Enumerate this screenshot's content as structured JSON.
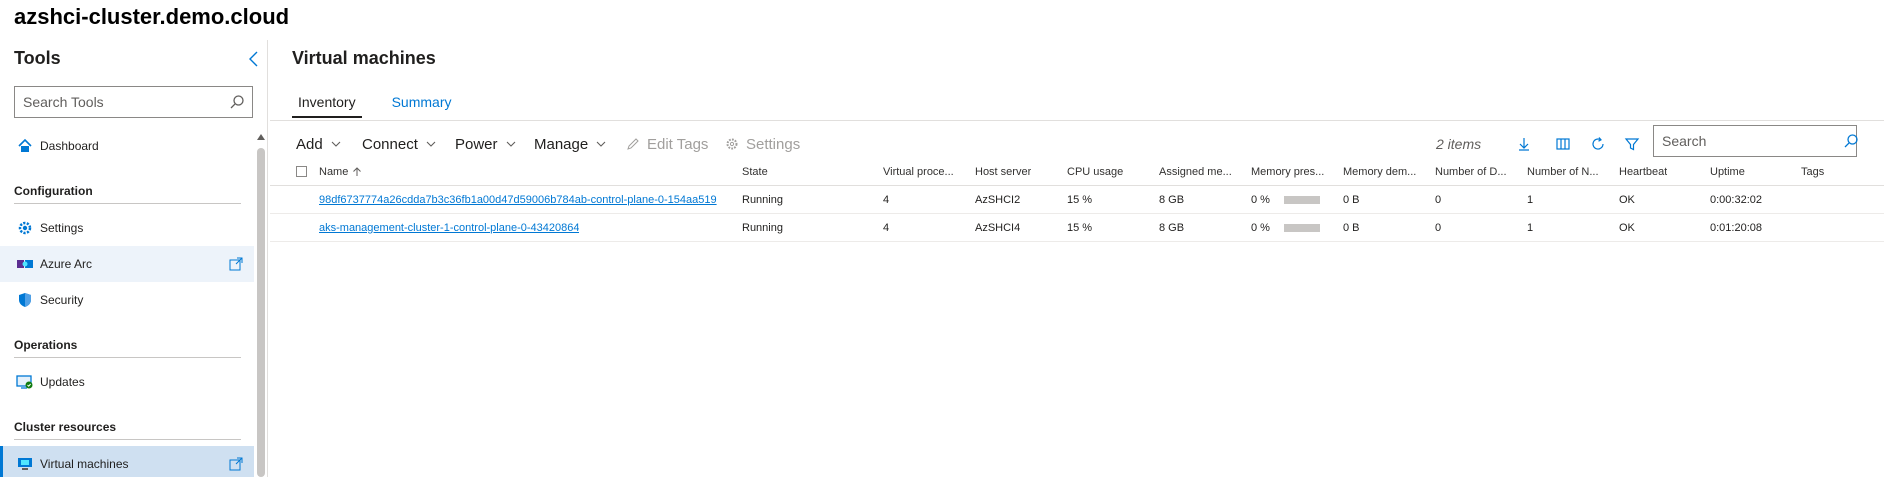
{
  "app": {
    "title": "azshci-cluster.demo.cloud"
  },
  "sidebar": {
    "header": "Tools",
    "search_placeholder": "Search Tools",
    "items": [
      {
        "type": "item",
        "label": "Dashboard",
        "icon": "home-icon"
      },
      {
        "type": "group",
        "label": "Configuration"
      },
      {
        "type": "item",
        "label": "Settings",
        "icon": "gear-icon"
      },
      {
        "type": "item",
        "label": "Azure Arc",
        "icon": "azure-arc-icon",
        "external": true
      },
      {
        "type": "item",
        "label": "Security",
        "icon": "shield-icon"
      },
      {
        "type": "group",
        "label": "Operations"
      },
      {
        "type": "item",
        "label": "Updates",
        "icon": "updates-icon"
      },
      {
        "type": "group",
        "label": "Cluster resources"
      },
      {
        "type": "item",
        "label": "Virtual machines",
        "icon": "vm-icon",
        "external": true,
        "selected": true
      }
    ]
  },
  "main": {
    "title": "Virtual machines",
    "tabs": [
      {
        "label": "Inventory",
        "active": true
      },
      {
        "label": "Summary",
        "active": false
      }
    ],
    "toolbar": {
      "add": "Add",
      "connect": "Connect",
      "power": "Power",
      "manage": "Manage",
      "edit_tags": "Edit Tags",
      "settings": "Settings",
      "items_count": "2 items",
      "search_placeholder": "Search"
    },
    "table": {
      "columns": [
        "Name",
        "State",
        "Virtual proce...",
        "Host server",
        "CPU usage",
        "Assigned me...",
        "Memory pres...",
        "Memory dem...",
        "Number of D...",
        "Number of N...",
        "Heartbeat",
        "Uptime",
        "Tags"
      ],
      "rows": [
        {
          "name": "98df6737774a26cdda7b3c36fb1a00d47d59006b784ab-control-plane-0-154aa519",
          "state": "Running",
          "vprocs": "4",
          "host": "AzSHCI2",
          "cpu": "15 %",
          "assigned_mem": "8 GB",
          "mem_pressure": "0 %",
          "mem_demand": "0 B",
          "num_disks": "0",
          "num_nics": "1",
          "heartbeat": "OK",
          "uptime": "0:00:32:02",
          "tags": ""
        },
        {
          "name": "aks-management-cluster-1-control-plane-0-43420864",
          "state": "Running",
          "vprocs": "4",
          "host": "AzSHCI4",
          "cpu": "15 %",
          "assigned_mem": "8 GB",
          "mem_pressure": "0 %",
          "mem_demand": "0 B",
          "num_disks": "0",
          "num_nics": "1",
          "heartbeat": "OK",
          "uptime": "0:01:20:08",
          "tags": ""
        }
      ]
    }
  },
  "colors": {
    "accent": "#0078d4",
    "selected_bg": "#cfe0f1",
    "hover_bg": "#edf3fa"
  }
}
